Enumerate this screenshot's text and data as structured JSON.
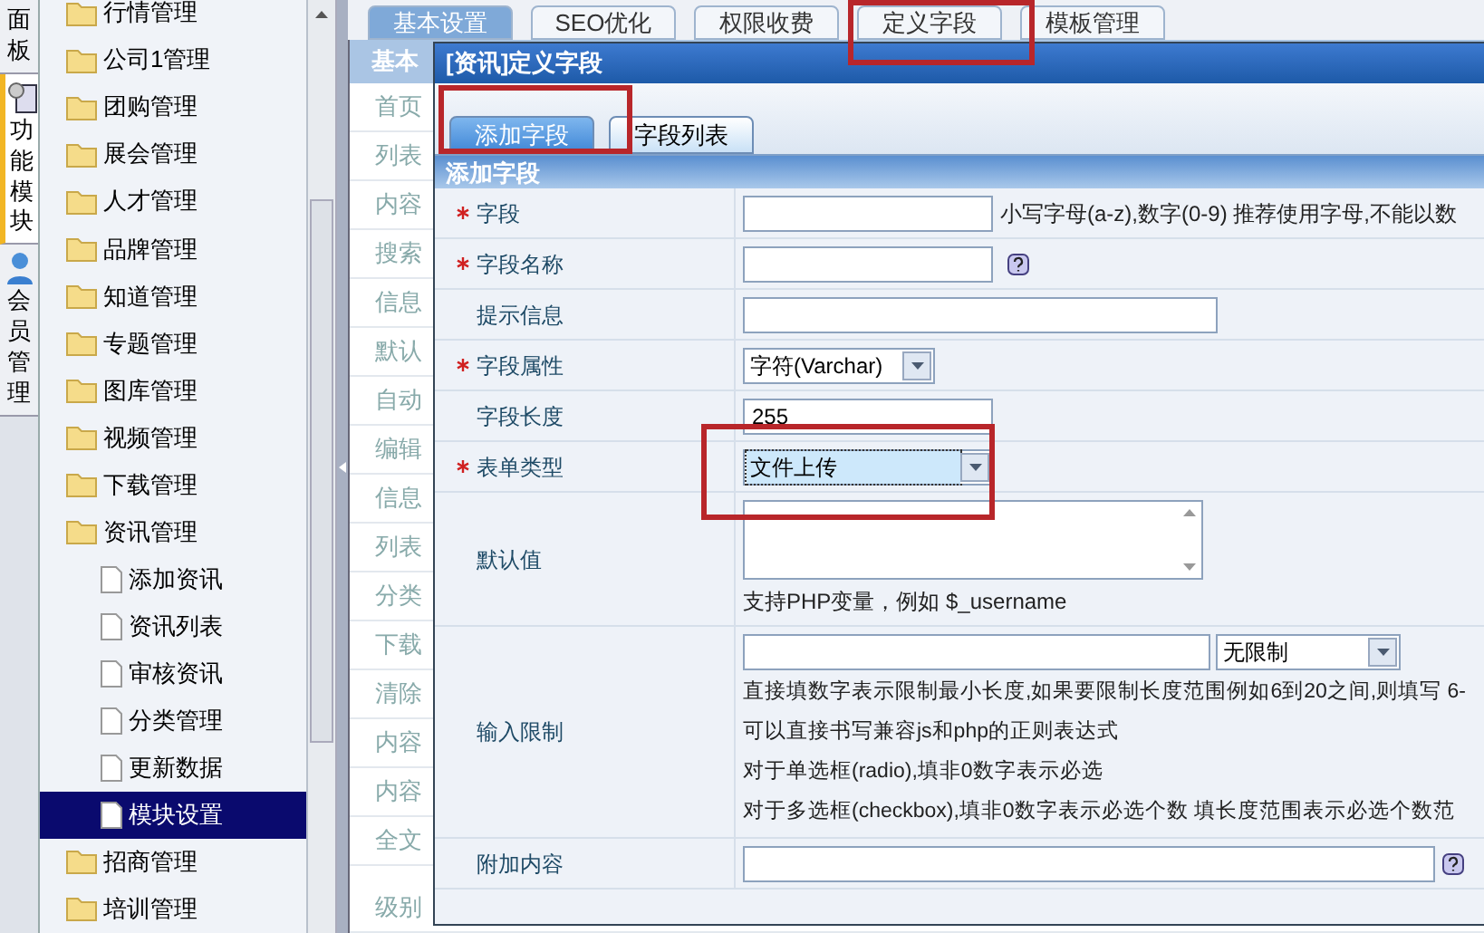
{
  "side_tabs": [
    {
      "label": "面板",
      "selected": false
    },
    {
      "label": "功能模块",
      "selected": true
    },
    {
      "label": "会员管理",
      "selected": false
    }
  ],
  "tree": [
    {
      "label": "行情管理",
      "kind": "folder",
      "selected": false
    },
    {
      "label": "公司1管理",
      "kind": "folder",
      "selected": false
    },
    {
      "label": "团购管理",
      "kind": "folder",
      "selected": false
    },
    {
      "label": "展会管理",
      "kind": "folder",
      "selected": false
    },
    {
      "label": "人才管理",
      "kind": "folder",
      "selected": false
    },
    {
      "label": "品牌管理",
      "kind": "folder",
      "selected": false
    },
    {
      "label": "知道管理",
      "kind": "folder",
      "selected": false
    },
    {
      "label": "专题管理",
      "kind": "folder",
      "selected": false
    },
    {
      "label": "图库管理",
      "kind": "folder",
      "selected": false
    },
    {
      "label": "视频管理",
      "kind": "folder",
      "selected": false
    },
    {
      "label": "下载管理",
      "kind": "folder",
      "selected": false
    },
    {
      "label": "资讯管理",
      "kind": "folder",
      "selected": false,
      "children": [
        {
          "label": "添加资讯",
          "kind": "page",
          "selected": false
        },
        {
          "label": "资讯列表",
          "kind": "page",
          "selected": false
        },
        {
          "label": "审核资讯",
          "kind": "page",
          "selected": false
        },
        {
          "label": "分类管理",
          "kind": "page",
          "selected": false
        },
        {
          "label": "更新数据",
          "kind": "page",
          "selected": false
        },
        {
          "label": "模块设置",
          "kind": "page",
          "selected": true
        }
      ]
    },
    {
      "label": "招商管理",
      "kind": "folder",
      "selected": false
    },
    {
      "label": "培训管理",
      "kind": "folder",
      "selected": false
    }
  ],
  "main_tabs": [
    {
      "label": "基本设置",
      "selected": true
    },
    {
      "label": "SEO优化",
      "selected": false
    },
    {
      "label": "权限收费",
      "selected": false
    },
    {
      "label": "定义字段",
      "selected": false
    },
    {
      "label": "模板管理",
      "selected": false
    }
  ],
  "settings": {
    "header": "基本",
    "labels": [
      "首页",
      "列表",
      "内容",
      "搜索",
      "信息",
      "默认",
      "自动",
      "编辑",
      "信息",
      "列表",
      "分类",
      "下载",
      "清除",
      "内容",
      "内容",
      "全文",
      "级别"
    ]
  },
  "dialog": {
    "title": "[资讯]定义字段",
    "tabs": [
      {
        "label": "添加字段",
        "selected": true
      },
      {
        "label": "字段列表",
        "selected": false
      }
    ],
    "section": "添加字段",
    "rows": [
      {
        "label": "字段",
        "required": true,
        "kind": "short-input",
        "note": "小写字母(a-z),数字(0-9) 推荐使用字母,不能以数"
      },
      {
        "label": "字段名称",
        "required": true,
        "kind": "short-input",
        "help": true
      },
      {
        "label": "提示信息",
        "required": false,
        "kind": "long-input"
      },
      {
        "label": "字段属性",
        "required": true,
        "kind": "select",
        "value": "字符(Varchar)",
        "focused": false
      },
      {
        "label": "字段长度",
        "required": false,
        "kind": "short-input",
        "value": "255"
      },
      {
        "label": "表单类型",
        "required": true,
        "kind": "select",
        "value": "文件上传",
        "focused": true
      },
      {
        "label": "默认值",
        "required": false,
        "kind": "textarea",
        "notes": [
          "支持PHP变量，例如 $_username"
        ]
      },
      {
        "label": "输入限制",
        "required": false,
        "kind": "input-select",
        "value": "无限制",
        "notes": [
          "直接填数字表示限制最小长度,如果要限制长度范围例如6到20之间,则填写 6-",
          "可以直接书写兼容js和php的正则表达式",
          "对于单选框(radio),填非0数字表示必选",
          "对于多选框(checkbox),填非0数字表示必选个数 填长度范围表示必选个数范"
        ]
      },
      {
        "label": "附加内容",
        "required": false,
        "kind": "long-input",
        "help": true
      }
    ]
  }
}
